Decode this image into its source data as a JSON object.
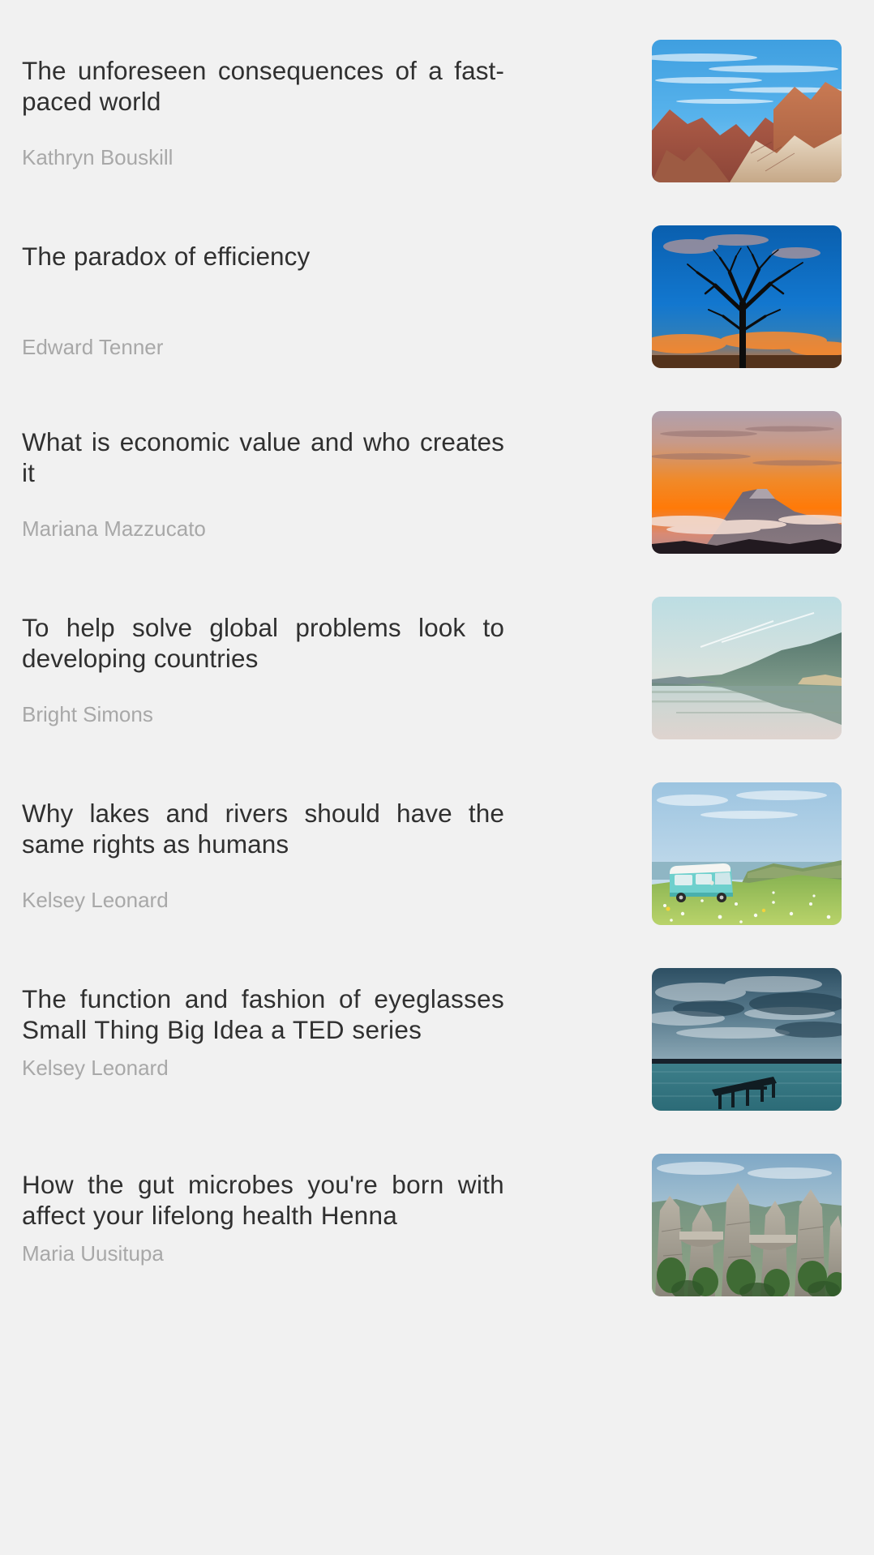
{
  "screen": {
    "background_color": "#f1f1f1",
    "title_color": "#303030",
    "author_color": "#a8a8a8"
  },
  "list": {
    "items": [
      {
        "title": "The unforeseen consequences of a fast-paced world",
        "author": "Kathryn Bouskill",
        "thumbnail": "red-rock-canyon-blue-sky-image",
        "lines": 2
      },
      {
        "title": "The paradox of efficiency",
        "author": "Edward Tenner",
        "thumbnail": "bare-tree-silhouette-sunset-image",
        "lines": 1
      },
      {
        "title": "What is economic value and who creates it",
        "author": "Mariana Mazzucato",
        "thumbnail": "mount-fuji-orange-sunset-image",
        "lines": 2
      },
      {
        "title": "To help solve global problems look to developing countries",
        "author": "Bright Simons",
        "thumbnail": "calm-lake-mountain-reflection-image",
        "lines": 2
      },
      {
        "title": "Why lakes and rivers should have the same rights as humans",
        "author": "Kelsey Leonard",
        "thumbnail": "teal-camper-van-meadow-image",
        "lines": 2
      },
      {
        "title": "The function and fashion of eyeglasses Small Thing Big Idea a TED series",
        "author": "Kelsey Leonard",
        "thumbnail": "wooden-pier-dusk-water-image",
        "lines": 3
      },
      {
        "title": "How the gut microbes you're born with affect your lifelong health Henna",
        "author": "Maria Uusitupa",
        "thumbnail": "sandstone-rock-formations-bridge-image",
        "lines": 3
      }
    ]
  }
}
